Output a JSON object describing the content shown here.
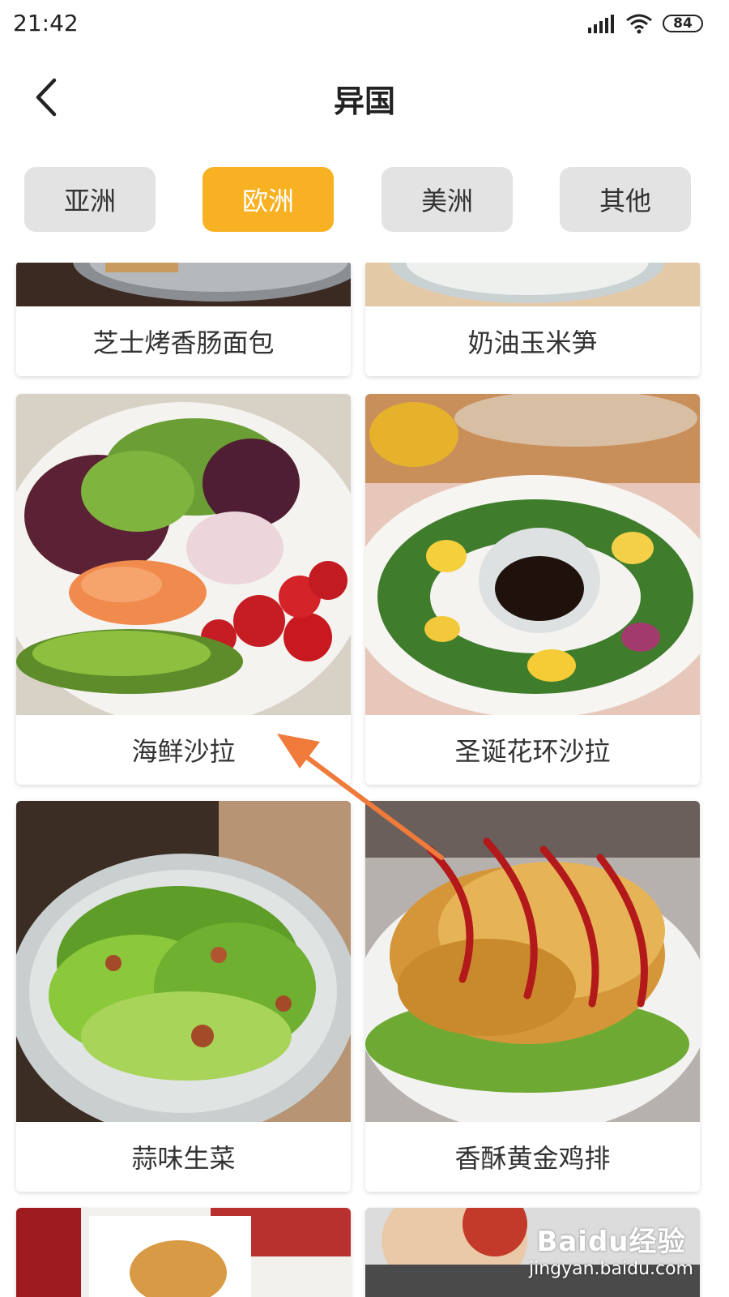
{
  "status": {
    "time": "21:42",
    "battery": "84"
  },
  "header": {
    "title": "异国"
  },
  "tabs": [
    {
      "label": "亚洲",
      "active": false
    },
    {
      "label": "欧洲",
      "active": true
    },
    {
      "label": "美洲",
      "active": false
    },
    {
      "label": "其他",
      "active": false
    }
  ],
  "recipes": [
    {
      "name": "芝士烤香肠面包"
    },
    {
      "name": "奶油玉米笋"
    },
    {
      "name": "海鲜沙拉"
    },
    {
      "name": "圣诞花环沙拉"
    },
    {
      "name": "蒜味生菜"
    },
    {
      "name": "香酥黄金鸡排"
    }
  ],
  "watermark": {
    "brand": "Baidu经验",
    "url": "jingyan.baidu.com"
  },
  "colors": {
    "accent": "#f7b123",
    "tab_inactive": "#e3e3e3",
    "annotation_arrow": "#f07a3a"
  }
}
